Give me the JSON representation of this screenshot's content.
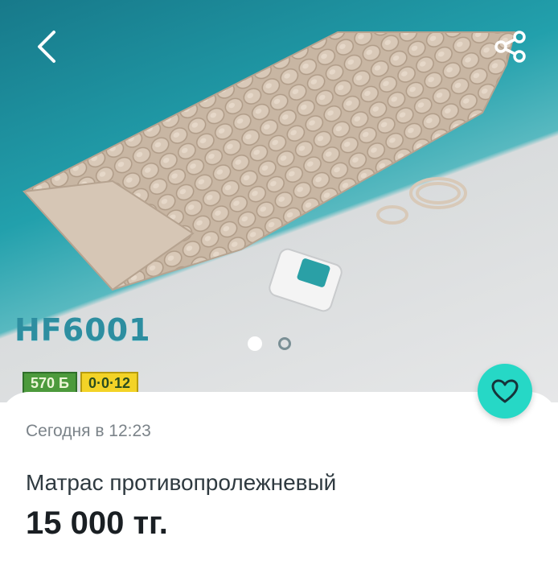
{
  "listing": {
    "date": "Сегодня в 12:23",
    "title": "Матрас противопролежневый",
    "price": "15 000 тг."
  },
  "gallery": {
    "model_label": "HF6001",
    "badge_points": "570 Б",
    "badge_timer": "0·0·12",
    "slide_count": 2,
    "active_slide": 1
  },
  "icons": {
    "back": "chevron-left-icon",
    "share": "share-icon",
    "favorite": "heart-icon"
  },
  "colors": {
    "accent": "#26d8c6",
    "hero_teal": "#22a0ac",
    "badge_green": "#4c9a3c",
    "badge_yellow": "#f3d327"
  }
}
